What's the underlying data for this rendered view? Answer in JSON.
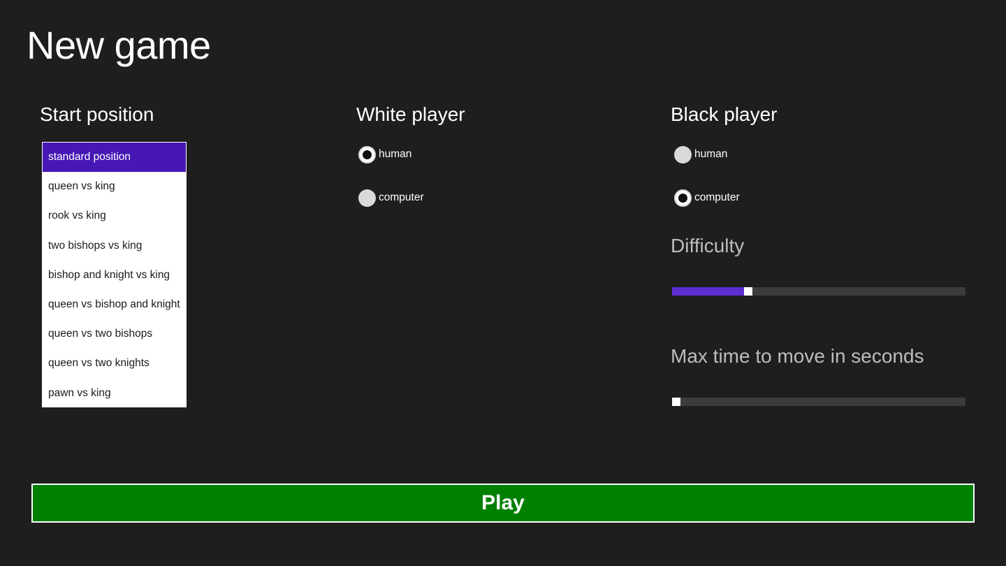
{
  "page": {
    "title": "New game"
  },
  "start_position": {
    "heading": "Start position",
    "selected_index": 0,
    "items": [
      {
        "label": "standard position"
      },
      {
        "label": "queen vs king"
      },
      {
        "label": "rook vs king"
      },
      {
        "label": "two bishops vs king"
      },
      {
        "label": "bishop and knight vs king"
      },
      {
        "label": "queen vs bishop and knight"
      },
      {
        "label": "queen vs two bishops"
      },
      {
        "label": "queen vs two knights"
      },
      {
        "label": "pawn vs king"
      }
    ]
  },
  "white_player": {
    "heading": "White player",
    "options": [
      {
        "label": "human",
        "checked": true
      },
      {
        "label": "computer",
        "checked": false
      }
    ]
  },
  "black_player": {
    "heading": "Black player",
    "options": [
      {
        "label": "human",
        "checked": false
      },
      {
        "label": "computer",
        "checked": true
      }
    ],
    "difficulty": {
      "label": "Difficulty",
      "fraction": 0.26
    },
    "max_time": {
      "label": "Max time to move in seconds",
      "fraction": 0.015
    }
  },
  "play_button": {
    "label": "Play"
  },
  "colors": {
    "background": "#1e1e1e",
    "accent": "#4617b4",
    "slider_fill": "#5b2fd3",
    "play_green": "#008000"
  }
}
